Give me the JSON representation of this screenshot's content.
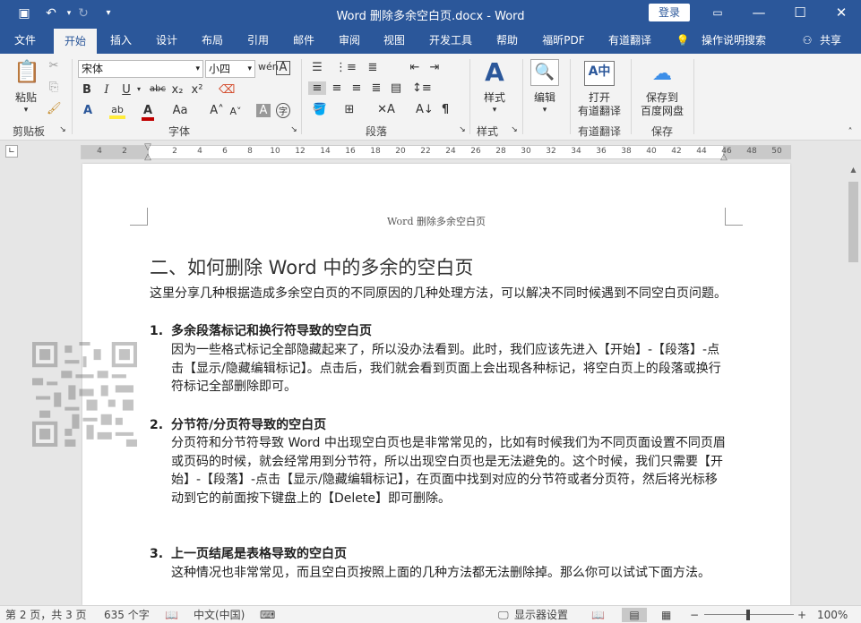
{
  "titlebar": {
    "title": "Word 删除多余空白页.docx  -  Word",
    "login_label": "登录",
    "qa_save_icon": "save-icon",
    "qa_undo_icon": "undo-icon",
    "qa_redo_icon": "redo-icon"
  },
  "tabs": [
    "文件",
    "开始",
    "插入",
    "设计",
    "布局",
    "引用",
    "邮件",
    "审阅",
    "视图",
    "开发工具",
    "帮助",
    "福昕PDF",
    "有道翻译",
    "操作说明搜索",
    "共享"
  ],
  "ribbon": {
    "clipboard": {
      "paste": "粘贴",
      "label": "剪贴板"
    },
    "font": {
      "name": "宋体",
      "size": "小四",
      "label": "字体"
    },
    "paragraph": {
      "label": "段落"
    },
    "styles": {
      "button": "样式",
      "label": "样式"
    },
    "editing": {
      "button": "编辑"
    },
    "youdao": {
      "line1": "打开",
      "line2": "有道翻译",
      "label": "有道翻译"
    },
    "save": {
      "line1": "保存到",
      "line2": "百度网盘",
      "label": "保存"
    }
  },
  "ruler": {
    "ticks": [
      "4",
      "2",
      "2",
      "4",
      "6",
      "8",
      "10",
      "12",
      "14",
      "16",
      "18",
      "20",
      "22",
      "24",
      "26",
      "28",
      "30",
      "32",
      "34",
      "36",
      "38",
      "40",
      "42",
      "44",
      "46",
      "48",
      "50"
    ]
  },
  "document": {
    "header": "Word 删除多余空白页",
    "heading": "二、如何删除 Word 中的多余的空白页",
    "intro": "这里分享几种根据造成多余空白页的不同原因的几种处理方法，可以解决不同时候遇到不同空白页问题。",
    "items": [
      {
        "num": "1.",
        "title": "多余段落标记和换行符导致的空白页",
        "body": "因为一些格式标记全部隐藏起来了，所以没办法看到。此时，我们应该先进入【开始】-【段落】-点击【显示/隐藏编辑标记】。点击后，我们就会看到页面上会出现各种标记，将空白页上的段落或换行符标记全部删除即可。"
      },
      {
        "num": "2.",
        "title": "分节符/分页符导致的空白页",
        "body": "分页符和分节符导致 Word 中出现空白页也是非常常见的，比如有时候我们为不同页面设置不同页眉或页码的时候，就会经常用到分节符，所以出现空白页也是无法避免的。这个时候，我们只需要【开始】-【段落】-点击【显示/隐藏编辑标记】，在页面中找到对应的分节符或者分页符，然后将光标移动到它的前面按下键盘上的【Delete】即可删除。"
      },
      {
        "num": "3.",
        "title": "上一页结尾是表格导致的空白页",
        "body": "这种情况也非常常见，而且空白页按照上面的几种方法都无法删除掉。那么你可以试试下面方法。"
      }
    ]
  },
  "status": {
    "page": "第 2 页，共 3 页",
    "words": "635 个字",
    "lang": "中文(中国)",
    "display": "显示器设置",
    "zoom": "100%"
  }
}
